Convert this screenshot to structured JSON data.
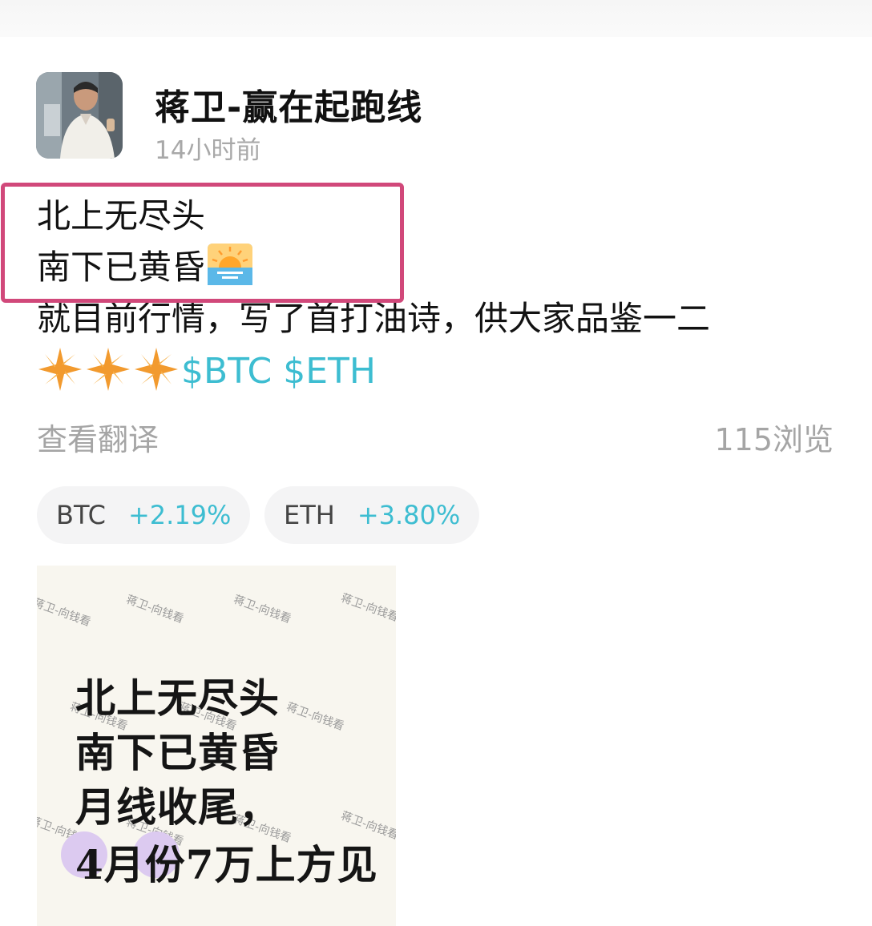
{
  "author": {
    "name": "蒋卫-赢在起跑线",
    "time": "14小时前"
  },
  "post": {
    "lines": [
      "北上无尽头",
      "南下已黄昏",
      "就目前行情，写了首打油诗，供大家品鉴一二"
    ],
    "tickers": [
      "$BTC",
      "$ETH"
    ],
    "translate_label": "查看翻译",
    "views": "115浏览"
  },
  "coins": [
    {
      "symbol": "BTC",
      "change": "+2.19%"
    },
    {
      "symbol": "ETH",
      "change": "+3.80%"
    }
  ],
  "image": {
    "watermark": "蒋卫-向钱看",
    "lines": [
      "北上无尽头",
      "南下已黄昏",
      "月线收尾，",
      "4月份7万上方见"
    ]
  },
  "colors": {
    "accent_cyan": "#3dbdd1",
    "highlight_border": "#d1487a",
    "muted_text": "#a5a5a5"
  },
  "icons": [
    "sunrise-emoji",
    "star-emoji"
  ]
}
